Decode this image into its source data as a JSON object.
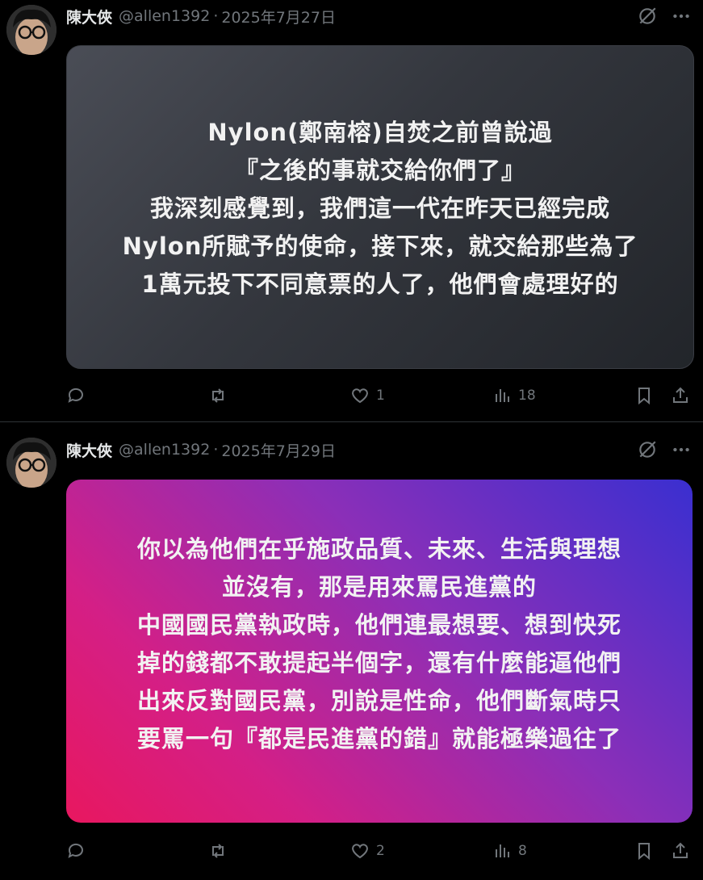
{
  "posts": [
    {
      "author_name": "陳大俠",
      "handle": "@allen1392",
      "separator": "·",
      "date": "2025年7月27日",
      "card_lines": [
        "Nylon(鄭南榕)自焚之前曾說過",
        "『之後的事就交給你們了』",
        "我深刻感覺到，我們這一代在昨天已經完成",
        "Nylon所賦予的使命，接下來，就交給那些為了",
        "1萬元投下不同意票的人了，他們會處理好的"
      ],
      "likes": "1",
      "views": "18",
      "card_style": "dark"
    },
    {
      "author_name": "陳大俠",
      "handle": "@allen1392",
      "separator": "·",
      "date": "2025年7月29日",
      "card_lines": [
        "你以為他們在乎施政品質、未來、生活與理想",
        "並沒有，那是用來罵民進黨的",
        "中國國民黨執政時，他們連最想要、想到快死",
        "掉的錢都不敢提起半個字，還有什麼能逼他們",
        "出來反對國民黨，別說是性命，他們斷氣時只",
        "要罵一句『都是民進黨的錯』就能極樂過往了"
      ],
      "likes": "2",
      "views": "8",
      "card_style": "magenta"
    }
  ],
  "icons": [
    "avatar",
    "grok-icon",
    "more-icon",
    "reply-icon",
    "repost-icon",
    "like-icon",
    "views-icon",
    "bookmark-icon",
    "share-icon"
  ],
  "colors": {
    "background": "#000000",
    "muted": "#71767b",
    "text": "#e7e9ea",
    "divider": "#2f3336"
  }
}
